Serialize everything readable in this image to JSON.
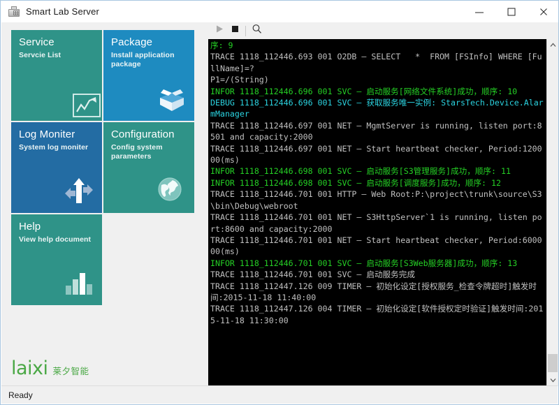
{
  "window": {
    "title": "Smart Lab Server",
    "icon": "server-rack-icon",
    "controls": {
      "minimize": "minimize-icon",
      "maximize": "maximize-icon",
      "close": "close-icon"
    }
  },
  "tiles": [
    {
      "title": "Service",
      "subtitle": "Servcie List",
      "color": "#2f9388",
      "icon": "line-chart-icon"
    },
    {
      "title": "Package",
      "subtitle": "Install application package",
      "color": "#1e8bc0",
      "icon": "open-box-icon"
    },
    {
      "title": "Log Moniter",
      "subtitle": "System log moniter",
      "color": "#236ca3",
      "icon": "arrows-up-icon"
    },
    {
      "title": "Configuration",
      "subtitle": "Config system parameters",
      "color": "#2f9388",
      "icon": "globe-icon"
    },
    {
      "title": "Help",
      "subtitle": "View help document",
      "color": "#2f9388",
      "icon": "bar-chart-icon"
    }
  ],
  "logo": {
    "main": "laixi",
    "chinese": "莱夕智能",
    "color": "#4aa845"
  },
  "log_toolbar": {
    "play": "play-icon",
    "stop": "stop-icon",
    "search": "search-icon"
  },
  "log_lines": [
    {
      "level": "seq",
      "text": "序: 9"
    },
    {
      "level": "trace",
      "text": "TRACE 1118_112446.693 001 O2DB – SELECT   *  FROM [FSInfo] WHERE [FullName]=?"
    },
    {
      "level": "trace",
      "text": "P1=/(String)"
    },
    {
      "level": "infor",
      "text": "INFOR 1118_112446.696 001 SVC – 启动服务[网络文件系统]成功，顺序: 10"
    },
    {
      "level": "debug",
      "text": "DEBUG 1118_112446.696 001 SVC – 获取服务唯一实例: StarsTech.Device.AlarmManager"
    },
    {
      "level": "trace",
      "text": "TRACE 1118_112446.697 001 NET – MgmtServer is running, listen port:8501 and capacity:2000"
    },
    {
      "level": "trace",
      "text": "TRACE 1118_112446.697 001 NET – Start heartbeat checker, Period:120000(ms)"
    },
    {
      "level": "infor",
      "text": "INFOR 1118_112446.698 001 SVC – 启动服务[S3管理服务]成功，顺序: 11"
    },
    {
      "level": "infor",
      "text": "INFOR 1118_112446.698 001 SVC – 启动服务[调度服务]成功，顺序: 12"
    },
    {
      "level": "trace",
      "text": "TRACE 1118_112446.701 001 HTTP – Web Root:P:\\project\\trunk\\source\\S3\\bin\\Debug\\webroot"
    },
    {
      "level": "trace",
      "text": "TRACE 1118_112446.701 001 NET – S3HttpServer`1 is running, listen port:8600 and capacity:2000"
    },
    {
      "level": "trace",
      "text": "TRACE 1118_112446.701 001 NET – Start heartbeat checker, Period:600000(ms)"
    },
    {
      "level": "infor",
      "text": "INFOR 1118_112446.701 001 SVC – 启动服务[S3Web服务器]成功，顺序: 13"
    },
    {
      "level": "trace",
      "text": "TRACE 1118_112446.701 001 SVC – 启动服务完成"
    },
    {
      "level": "trace",
      "text": "TRACE 1118_112447.126 009 TIMER – 初始化设定[授权服务_检查令牌超时]触发时间:2015-11-18 11:40:00"
    },
    {
      "level": "trace",
      "text": "TRACE 1118_112447.126 004 TIMER – 初始化设定[软件授权定时验证]触发时间:2015-11-18 11:30:00"
    }
  ],
  "scrollbar": {
    "up": "chevron-up-icon",
    "down": "chevron-down-icon"
  },
  "status": {
    "text": "Ready"
  }
}
